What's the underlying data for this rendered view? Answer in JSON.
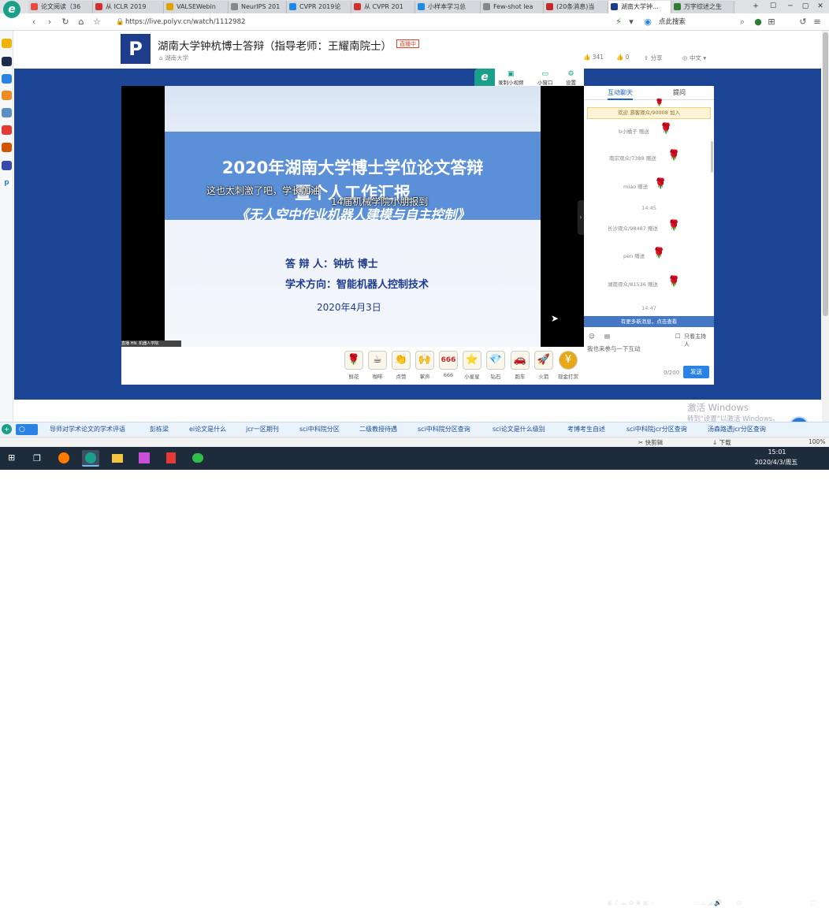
{
  "browser": {
    "tabs": [
      {
        "label": "论文阅读（36",
        "color": "#e74c3c"
      },
      {
        "label": "从 ICLR 2019",
        "color": "#d32f2f"
      },
      {
        "label": "VALSEWebin",
        "color": "#e1a100"
      },
      {
        "label": "NeurIPS 201",
        "color": "#888888"
      },
      {
        "label": "CVPR 2019论",
        "color": "#1e88e5"
      },
      {
        "label": "从 CVPR 201",
        "color": "#d32f2f"
      },
      {
        "label": "小样本学习总",
        "color": "#1e88e5"
      },
      {
        "label": "Few-shot lea",
        "color": "#888888"
      },
      {
        "label": "(20条消息)当",
        "color": "#c62828"
      },
      {
        "label": "湖南大学钟…",
        "color": "#1e3c8c"
      },
      {
        "label": "万字综述之生",
        "color": "#2e7d32"
      }
    ],
    "new_tab": "+",
    "url": "https://live.polyv.cn/watch/1112982",
    "search_placeholder": "点此搜索",
    "window_controls": [
      "☐",
      "─",
      "▢",
      "✕"
    ]
  },
  "page": {
    "title": "湖南大学钟杭博士答辩（指导老师：王耀南院士）",
    "follow_badge": "直播中",
    "org": "湖南大学",
    "likes": "341",
    "share_count": "0",
    "share_label": "分享",
    "language": "中文"
  },
  "player": {
    "toolbar": {
      "record": "录制小视频",
      "mini": "小窗口",
      "settings": "设置"
    },
    "e_badge": "e",
    "video_tag": "直播 HN. 机器人学院",
    "slide": {
      "title_line1": "2020年湖南大学博士学位论文答辩",
      "title_line2": "暨个人工作汇报",
      "title_line3": "《无人空中作业机器人建模与自主控制》",
      "defender": "答  辩  人：钟杭    博士",
      "direction": "学术方向：智能机器人控制技术",
      "date": "2020年4月3日"
    },
    "danmu": [
      "这也太刺激了吧，学长加油",
      "14届机械学院小朋报到"
    ]
  },
  "gifts": [
    {
      "icon": "🌹",
      "label": "鲜花"
    },
    {
      "icon": "☕",
      "label": "咖啡"
    },
    {
      "icon": "👏",
      "label": "点赞"
    },
    {
      "icon": "🙌",
      "label": "掌声"
    },
    {
      "icon": "666",
      "label": "666"
    },
    {
      "icon": "⭐",
      "label": "小星星"
    },
    {
      "icon": "💎",
      "label": "钻石"
    },
    {
      "icon": "🚗",
      "label": "跑车"
    },
    {
      "icon": "🚀",
      "label": "火箭"
    },
    {
      "icon": "¥",
      "label": "现金打赏"
    }
  ],
  "chat": {
    "tabs": [
      "互动聊天",
      "提问"
    ],
    "notice": "欢迎 游客观众/90008 加入",
    "messages": [
      {
        "user": "b小橘子 赠送"
      },
      {
        "user": "南宗观众/7388 赠送"
      },
      {
        "user": "miao 赠送"
      },
      {
        "user": "长沙观众/98487 赠送"
      },
      {
        "user": "pen 赠送"
      },
      {
        "user": "湖南观众/81536 赠送"
      }
    ],
    "times": [
      "14:45",
      "14:47"
    ],
    "new_messages": "有更多新消息，点击查看",
    "only_host": "只看主持人",
    "input_placeholder": "我也来参与一下互动",
    "count": "0/200",
    "send": "发送"
  },
  "bottom_links": [
    "导师对学术论文的学术评语",
    "彭栋梁",
    "ei论文是什么",
    "jcr一区期刊",
    "sci中科院分区",
    "二级教授待遇",
    "sci中科院分区查询",
    "sci论文是什么级别",
    "考博考生自述",
    "sci中科院jcr分区查询",
    "汤森路透jcr分区查询"
  ],
  "status": {
    "fast_edit": "快剪辑",
    "download": "下载",
    "zoom": "100%"
  },
  "watermark": {
    "line1": "激活 Windows",
    "line2": "转到\"设置\"以激活 Windows。"
  },
  "timer": "00:14",
  "taskbar": {
    "time": "15:01",
    "date": "2020/4/3/周五",
    "ime": "中"
  }
}
